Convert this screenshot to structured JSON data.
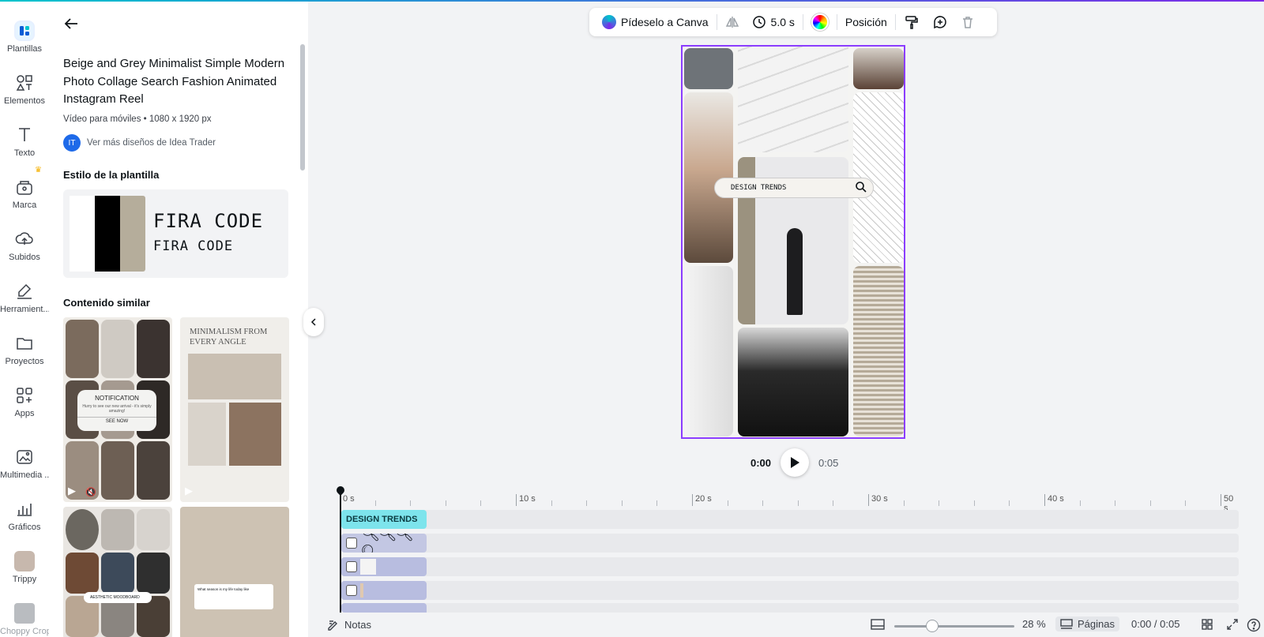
{
  "rail": {
    "items": [
      {
        "label": "Plantillas",
        "icon": "templates-icon"
      },
      {
        "label": "Elementos",
        "icon": "elements-icon"
      },
      {
        "label": "Texto",
        "icon": "text-icon"
      },
      {
        "label": "Marca",
        "icon": "brand-icon"
      },
      {
        "label": "Subidos",
        "icon": "upload-icon"
      },
      {
        "label": "Herramient...",
        "icon": "draw-icon"
      },
      {
        "label": "Proyectos",
        "icon": "folder-icon"
      },
      {
        "label": "Apps",
        "icon": "apps-icon"
      },
      {
        "label": "Multimedia ...",
        "icon": "media-icon"
      },
      {
        "label": "Gráficos",
        "icon": "charts-icon"
      },
      {
        "label": "Trippy",
        "icon": "trippy-app-icon"
      },
      {
        "label": "Choppy Crop",
        "icon": "choppy-crop-icon"
      }
    ]
  },
  "panel": {
    "title": "Beige and Grey Minimalist Simple Modern Photo Collage Search Fashion Animated Instagram Reel",
    "meta": "Vídeo para móviles • 1080 x 1920 px",
    "author_initials": "IT",
    "author_link": "Ver más diseños de Idea Trader",
    "style_heading": "Estilo de la plantilla",
    "font_big": "FIRA CODE",
    "font_small": "FIRA CODE",
    "swatches": [
      "#ffffff",
      "#000000",
      "#b5ad9b"
    ],
    "similar_heading": "Contenido similar",
    "thumb1": {
      "title": "NOTIFICATION",
      "sub": "Hurry to see our new arrival - it's simply amazing!",
      "cta": "SEE NOW"
    },
    "thumb2": {
      "title": "MINIMALISM FROM EVERY ANGLE"
    },
    "thumb3": {
      "search": "AESTHETIC MOODBOARD"
    },
    "thumb4": {
      "search": "What season is my life today like"
    }
  },
  "toolbar": {
    "ask_canva": "Pídeselo a Canva",
    "duration": "5.0 s",
    "position": "Posición"
  },
  "canvas": {
    "search_text": "DESIGN TRENDS"
  },
  "playback": {
    "current": "0:00",
    "total": "0:05"
  },
  "timeline": {
    "labels": [
      "0 s",
      "10 s",
      "20 s",
      "30 s",
      "40 s",
      "50 s"
    ],
    "text_clip": "DESIGN TRENDS"
  },
  "bottom": {
    "notes": "Notas",
    "zoom": "28 %",
    "pages": "Páginas",
    "time": "0:00 / 0:05"
  },
  "colors": {
    "accent": "#8b3dff",
    "brand": "#00c4cc",
    "text_clip": "#7de4ec"
  }
}
